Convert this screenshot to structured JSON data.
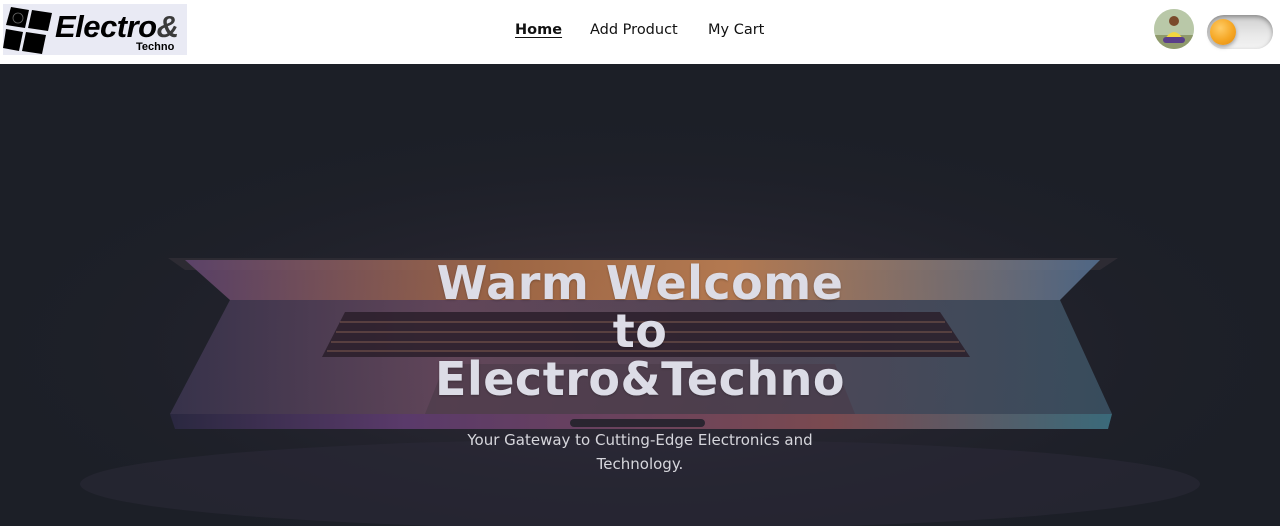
{
  "brand": {
    "name": "Electro",
    "ampersand": "&",
    "tagline": "Techno"
  },
  "nav": {
    "items": [
      {
        "label": "Home",
        "active": true
      },
      {
        "label": "Add Product",
        "active": false
      },
      {
        "label": "My Cart",
        "active": false
      }
    ]
  },
  "header_right": {
    "avatar_icon": "user-avatar",
    "theme_toggle_icon": "theme-toggle",
    "theme_toggle_on": false
  },
  "hero": {
    "title_lines": [
      "Warm Welcome",
      "to",
      "Electro&Techno"
    ],
    "subtitle": "Your Gateway to Cutting-Edge Electronics and Technology."
  },
  "colors": {
    "navbar_bg": "#ffffff",
    "hero_bg": "#1c1f27",
    "toggle_knob": "#f5a623",
    "logo_bg": "#e9eaf4"
  }
}
